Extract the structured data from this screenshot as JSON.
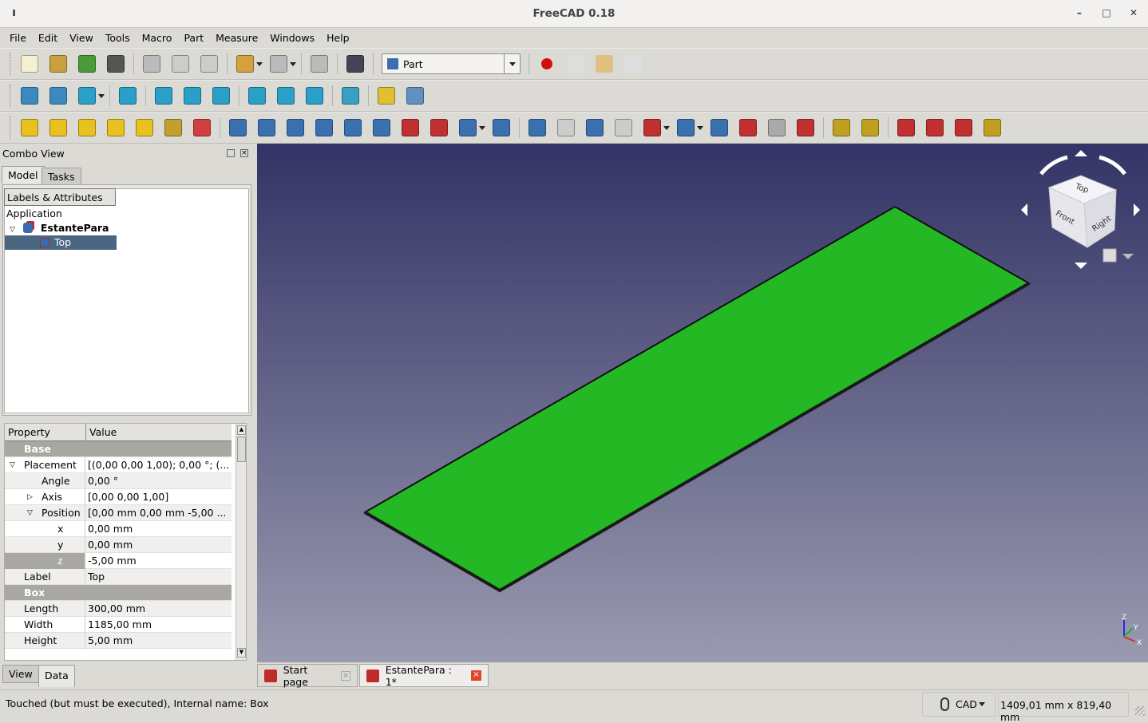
{
  "window": {
    "title": "FreeCAD 0.18",
    "minimize": "–",
    "maximize": "□",
    "close": "✕"
  },
  "menu": [
    "File",
    "Edit",
    "View",
    "Tools",
    "Macro",
    "Part",
    "Measure",
    "Windows",
    "Help"
  ],
  "toolbar1": {
    "icons": [
      [
        "new-document-icon",
        "#f5f0d0"
      ],
      [
        "open-icon",
        "#c9a040"
      ],
      [
        "import-icon",
        "#4a9a3a"
      ],
      [
        "print-icon",
        "#555"
      ],
      "sep",
      [
        "cut-icon",
        "#bbb"
      ],
      [
        "copy-icon",
        "#ccc"
      ],
      [
        "paste-icon",
        "#ccc"
      ],
      "sep",
      [
        "undo-icon",
        "#d4a040"
      ],
      "dd",
      [
        "redo-icon",
        "#bbb"
      ],
      "dd",
      "sep",
      [
        "refresh-icon",
        "#bbb"
      ],
      "sep",
      [
        "whats-this-icon",
        "#445"
      ]
    ],
    "workbench": "Part",
    "macro_icons": [
      [
        "record-macro-icon",
        "#d01010"
      ],
      [
        "stop-macro-icon",
        "#ddd"
      ],
      [
        "edit-macro-icon",
        "#e0c080"
      ],
      [
        "run-macro-icon",
        "#ddd"
      ]
    ]
  },
  "toolbar2": {
    "icons": [
      [
        "fit-all-icon",
        "#3a8ac0"
      ],
      [
        "fit-selection-icon",
        "#3a8ac0"
      ],
      [
        "draw-style-icon",
        "#2aa0c8"
      ],
      "dd",
      "sep",
      [
        "isometric-icon",
        "#2aa0c8"
      ],
      "sep",
      [
        "view-front-icon",
        "#2aa0c8"
      ],
      [
        "view-top-icon",
        "#2aa0c8"
      ],
      [
        "view-right-icon",
        "#2aa0c8"
      ],
      "sep",
      [
        "view-rear-icon",
        "#2aa0c8"
      ],
      [
        "view-bottom-icon",
        "#2aa0c8"
      ],
      [
        "view-left-icon",
        "#2aa0c8"
      ],
      "sep",
      [
        "measure-distance-icon",
        "#3aa0c0"
      ],
      "sep",
      [
        "part-icon",
        "#e0c030"
      ],
      [
        "group-icon",
        "#6090c0"
      ]
    ]
  },
  "toolbar3": {
    "icons": [
      [
        "box-icon",
        "#e8c020"
      ],
      [
        "cylinder-icon",
        "#e8c020"
      ],
      [
        "sphere-icon",
        "#e8c020"
      ],
      [
        "cone-icon",
        "#e8c020"
      ],
      [
        "torus-icon",
        "#e8c020"
      ],
      [
        "create-tube-icon",
        "#c0a030"
      ],
      [
        "primitives-icon",
        "#d04040"
      ],
      "sep",
      [
        "shape-builder-icon",
        "#3a70b0"
      ],
      [
        "revolve-icon",
        "#3a70b0"
      ],
      [
        "mirror-icon",
        "#3a70b0"
      ],
      [
        "fillet-icon",
        "#3a70b0"
      ],
      [
        "chamfer-icon",
        "#3a70b0"
      ],
      [
        "make-face-icon",
        "#3a70b0"
      ],
      [
        "ruled-surface-icon",
        "#c03030"
      ],
      [
        "loft-icon",
        "#c03030"
      ],
      [
        "sweep-icon",
        "#3a70b0"
      ],
      "dd",
      [
        "thickness-icon",
        "#3a70b0"
      ],
      "sep",
      [
        "boolean-icon",
        "#3a70b0"
      ],
      [
        "cut-icon",
        "#ccc"
      ],
      [
        "fuse-icon",
        "#3a70b0"
      ],
      [
        "common-icon",
        "#ccc"
      ],
      [
        "join-icon",
        "#c03030"
      ],
      "dd",
      [
        "split-icon",
        "#3a70b0"
      ],
      "dd",
      [
        "compound-icon",
        "#3a70b0"
      ],
      [
        "check-geometry-icon",
        "#c03030"
      ],
      [
        "defeaturing-icon",
        "#aaa"
      ],
      [
        "cross-sections-icon",
        "#c03030"
      ],
      "sep",
      [
        "measure-linear-icon",
        "#c0a020"
      ],
      [
        "measure-angular-icon",
        "#c0a020"
      ],
      "sep",
      [
        "measure-refresh-icon",
        "#c03030"
      ],
      [
        "measure-clear-icon",
        "#c03030"
      ],
      [
        "toggle-all-icon",
        "#c03030"
      ],
      [
        "toggle-3d-icon",
        "#c0a020"
      ]
    ]
  },
  "combo": {
    "title": "Combo View",
    "tabs": [
      "Model",
      "Tasks"
    ],
    "tree_header": "Labels & Attributes",
    "application": "Application",
    "document": "EstantePara",
    "object": "Top"
  },
  "properties": {
    "headers": [
      "Property",
      "Value"
    ],
    "rows": [
      {
        "group": "Base"
      },
      {
        "k": "Placement",
        "v": "[(0,00 0,00 1,00); 0,00 °; (...",
        "exp": "open",
        "lvl": 1
      },
      {
        "k": "Angle",
        "v": "0,00 °",
        "lvl": 2
      },
      {
        "k": "Axis",
        "v": "[0,00 0,00 1,00]",
        "exp": "closed",
        "lvl": 2
      },
      {
        "k": "Position",
        "v": "[0,00 mm  0,00 mm  -5,00 ...",
        "exp": "open",
        "lvl": 2
      },
      {
        "k": "x",
        "v": "0,00 mm",
        "lvl": 3
      },
      {
        "k": "y",
        "v": "0,00 mm",
        "lvl": 3
      },
      {
        "k": "z",
        "v": "-5,00 mm",
        "lvl": 3,
        "sel": true
      },
      {
        "k": "Label",
        "v": "Top",
        "lvl": 1
      },
      {
        "group": "Box"
      },
      {
        "k": "Length",
        "v": "300,00 mm",
        "lvl": 1
      },
      {
        "k": "Width",
        "v": "1185,00 mm",
        "lvl": 1
      },
      {
        "k": "Height",
        "v": "5,00 mm",
        "lvl": 1
      }
    ],
    "tabs": [
      "View",
      "Data"
    ]
  },
  "navcube": {
    "top": "Top",
    "front": "Front",
    "right": "Right"
  },
  "axis": {
    "x": "X",
    "y": "Y",
    "z": "Z"
  },
  "doc_tabs": [
    "Start page",
    "EstantePara : 1*"
  ],
  "status": {
    "message": "Touched (but must be executed), Internal name: Box",
    "nav_style": "CAD",
    "dimensions": "1409,01 mm x 819,40 mm"
  },
  "colors": {
    "shape": "#24b824",
    "selection": "#4a6680"
  }
}
